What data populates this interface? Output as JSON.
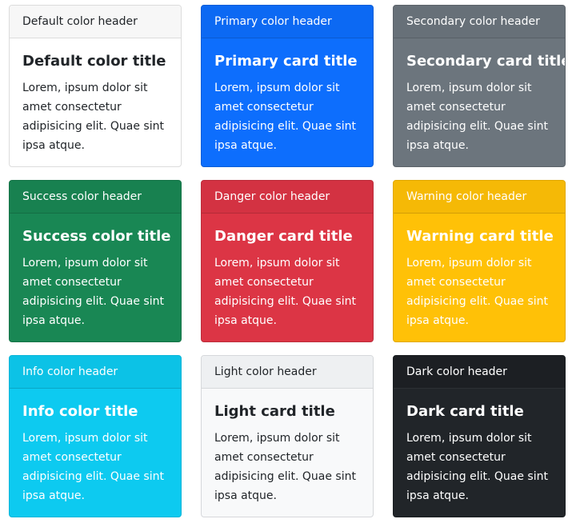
{
  "cards": [
    {
      "variant": "default",
      "header": "Default color header",
      "title": "Default color title",
      "text": "Lorem, ipsum dolor sit amet consectetur adipisicing elit. Quae sint ipsa atque.",
      "bg": "#ffffff"
    },
    {
      "variant": "primary",
      "header": "Primary color header",
      "title": "Primary card title",
      "text": "Lorem, ipsum dolor sit amet consectetur adipisicing elit. Quae sint ipsa atque.",
      "bg": "#0d6efd"
    },
    {
      "variant": "secondary",
      "header": "Secondary color header",
      "title": "Secondary card title",
      "text": "Lorem, ipsum dolor sit amet consectetur adipisicing elit. Quae sint ipsa atque.",
      "bg": "#6c757d"
    },
    {
      "variant": "success",
      "header": "Success color header",
      "title": "Success color title",
      "text": "Lorem, ipsum dolor sit amet consectetur adipisicing elit. Quae sint ipsa atque.",
      "bg": "#198754"
    },
    {
      "variant": "danger",
      "header": "Danger color header",
      "title": "Danger card title",
      "text": "Lorem, ipsum dolor sit amet consectetur adipisicing elit. Quae sint ipsa atque.",
      "bg": "#dc3545"
    },
    {
      "variant": "warning",
      "header": "Warning color header",
      "title": "Warning card title",
      "text": "Lorem, ipsum dolor sit amet consectetur adipisicing elit. Quae sint ipsa atque.",
      "bg": "#ffc107"
    },
    {
      "variant": "info",
      "header": "Info color header",
      "title": "Info color title",
      "text": "Lorem, ipsum dolor sit amet consectetur adipisicing elit. Quae sint ipsa atque.",
      "bg": "#0dcaf0"
    },
    {
      "variant": "light",
      "header": "Light color header",
      "title": "Light card title",
      "text": "Lorem, ipsum dolor sit amet consectetur adipisicing elit. Quae sint ipsa atque.",
      "bg": "#f8f9fa"
    },
    {
      "variant": "dark",
      "header": "Dark color header",
      "title": "Dark card title",
      "text": "Lorem, ipsum dolor sit amet consectetur adipisicing elit. Quae sint ipsa atque.",
      "bg": "#212529"
    }
  ]
}
